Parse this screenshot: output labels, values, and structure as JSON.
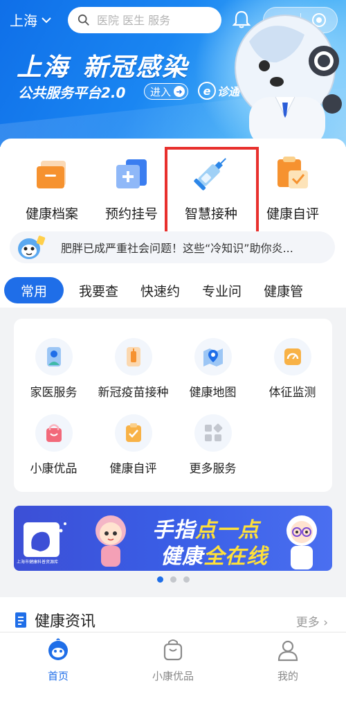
{
  "header": {
    "city": "上海",
    "search_placeholder": "医院 医生 服务",
    "banner_title_a": "上海",
    "banner_title_b": "新冠感染",
    "banner_subtitle": "公共服务平台2.0",
    "enter_label": "进入",
    "brand": "诊通"
  },
  "quick_actions": [
    {
      "label": "健康档案",
      "icon": "folder-icon"
    },
    {
      "label": "预约挂号",
      "icon": "plus-card-icon"
    },
    {
      "label": "智慧接种",
      "icon": "syringe-icon"
    },
    {
      "label": "健康自评",
      "icon": "clipboard-check-icon"
    }
  ],
  "notice": {
    "text": "肥胖已成严重社会问题！这些“冷知识”助你炎..."
  },
  "tabs": [
    "常用",
    "我要查",
    "快速约",
    "专业问",
    "健康管"
  ],
  "services": [
    {
      "label": "家医服务",
      "icon": "doctor-icon"
    },
    {
      "label": "新冠疫苗接种",
      "icon": "vaccine-vial-icon"
    },
    {
      "label": "健康地图",
      "icon": "map-pin-icon"
    },
    {
      "label": "体征监测",
      "icon": "gauge-icon"
    },
    {
      "label": "小康优品",
      "icon": "shopping-bag-icon"
    },
    {
      "label": "健康自评",
      "icon": "clipboard-check-icon"
    },
    {
      "label": "更多服务",
      "icon": "grid-more-icon"
    }
  ],
  "promo": {
    "line1_a": "手指",
    "line1_b": "点一点",
    "line2_a": "健康",
    "line2_b": "全在线",
    "logo_text": "上海市健康科普资源库"
  },
  "news": {
    "title": "健康资讯",
    "more": "更多 ›"
  },
  "bottom_nav": [
    {
      "label": "首页"
    },
    {
      "label": "小康优品"
    },
    {
      "label": "我的"
    }
  ],
  "colors": {
    "accent": "#1f6ee8",
    "highlight": "#e8302d",
    "yellow": "#ffe03a"
  }
}
